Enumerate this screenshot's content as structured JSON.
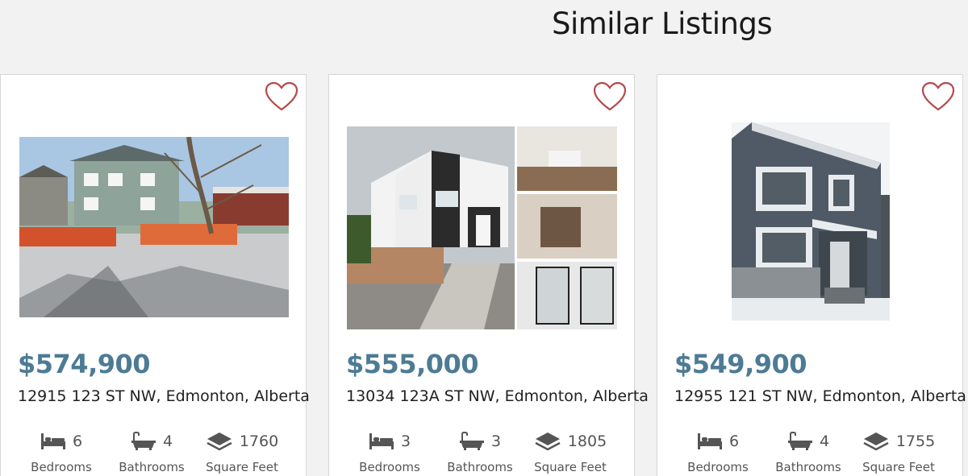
{
  "section": {
    "title": "Similar Listings"
  },
  "colors": {
    "price": "#4d7b95",
    "heart": "#b44a4a"
  },
  "icons": {
    "favorite": "heart-icon",
    "beds": "bed-icon",
    "baths": "bathtub-icon",
    "area": "square-feet-icon"
  },
  "listings": [
    {
      "price": "$574,900",
      "address": "12915 123 ST NW, Edmonton, Alberta",
      "bedrooms": "6",
      "bathrooms": "4",
      "square_feet": "1760",
      "labels": {
        "bedrooms": "Bedrooms",
        "bathrooms": "Bathrooms",
        "square_feet": "Square Feet"
      }
    },
    {
      "price": "$555,000",
      "address": "13034 123A ST NW, Edmonton, Alberta",
      "bedrooms": "3",
      "bathrooms": "3",
      "square_feet": "1805",
      "labels": {
        "bedrooms": "Bedrooms",
        "bathrooms": "Bathrooms",
        "square_feet": "Square Feet"
      }
    },
    {
      "price": "$549,900",
      "address": "12955 121 ST NW, Edmonton, Alberta",
      "bedrooms": "6",
      "bathrooms": "4",
      "square_feet": "1755",
      "labels": {
        "bedrooms": "Bedrooms",
        "bathrooms": "Bathrooms",
        "square_feet": "Square Feet"
      }
    }
  ]
}
